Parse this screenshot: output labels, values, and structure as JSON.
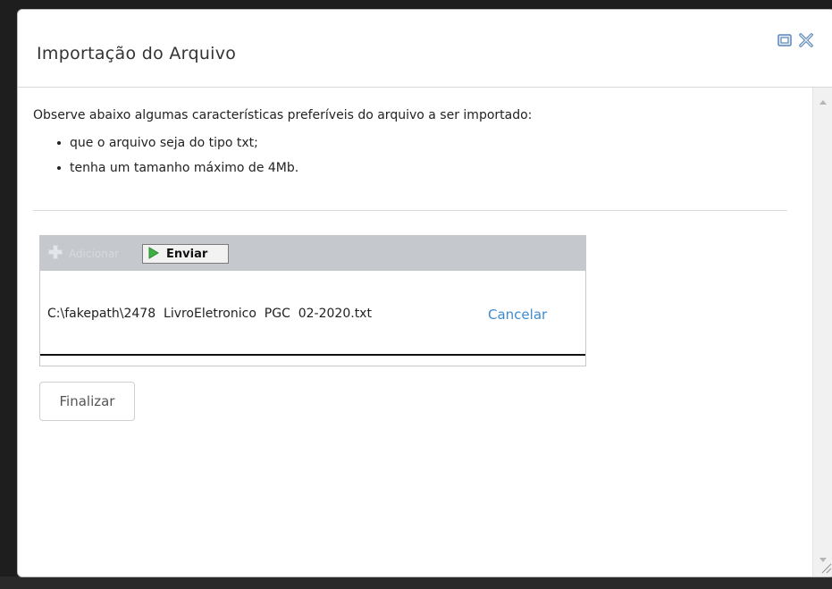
{
  "dialog": {
    "title": "Importação do Arquivo",
    "controls": {
      "restore_icon": "restore-window-icon",
      "close_icon": "close-icon"
    }
  },
  "content": {
    "intro": "Observe abaixo algumas características preferíveis do arquivo a ser importado:",
    "requirements": [
      "que o arquivo seja do tipo txt;",
      "tenha um tamanho máximo de 4Mb."
    ]
  },
  "uploader": {
    "add_label": "Adicionar",
    "send_label": "Enviar",
    "file_name": "C:\\fakepath\\2478  LivroEletronico  PGC  02-2020.txt",
    "cancel_label": "Cancelar"
  },
  "actions": {
    "finalize_label": "Finalizar"
  },
  "colors": {
    "accent_link": "#3d8ad1",
    "toolbar_bg": "#c5c9ce",
    "send_icon_green": "#3cb043"
  }
}
